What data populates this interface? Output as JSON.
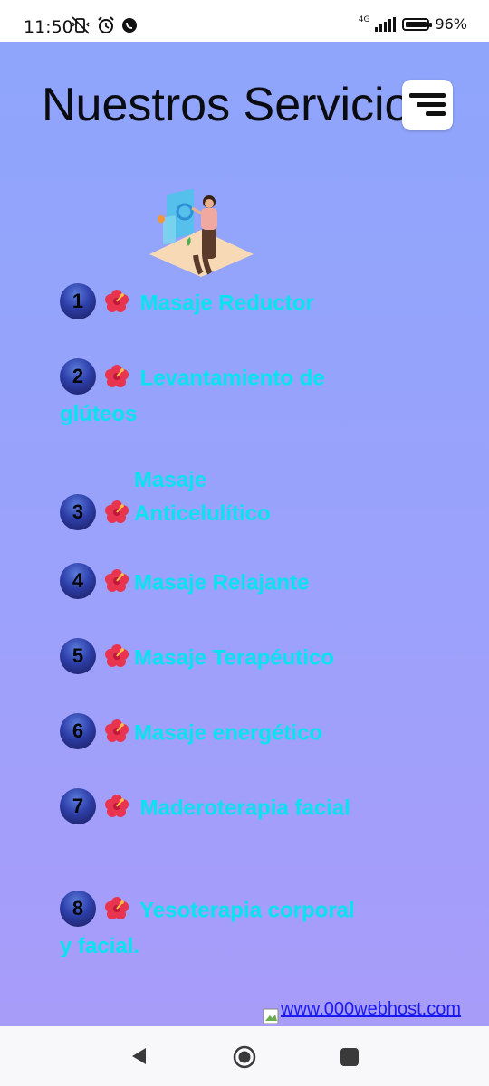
{
  "status_bar": {
    "time": "11:50",
    "network": "4G",
    "battery_percent": "96%",
    "battery_level": 0.96,
    "icons": [
      "vibrate-off-icon",
      "alarm-icon",
      "whatsapp-icon",
      "signal-icon",
      "battery-icon"
    ]
  },
  "page": {
    "title": "Nuestros Servicios",
    "menu_icon": "menu-icon",
    "background_gradient": [
      "#8ea5fb",
      "#a89cf9"
    ],
    "accent_text_color": "#07e3ef"
  },
  "services": [
    {
      "number": "1",
      "icon": "hibiscus-icon",
      "label": "Masaje Reductor"
    },
    {
      "number": "2",
      "icon": "hibiscus-icon",
      "label": "Levantamiento de glúteos"
    },
    {
      "number": "3",
      "icon": "hibiscus-icon",
      "label": "Masaje Anticelulítico"
    },
    {
      "number": "4",
      "icon": "hibiscus-icon",
      "label": "Masaje Relajante"
    },
    {
      "number": "5",
      "icon": "hibiscus-icon",
      "label": "Masaje Terapéutico"
    },
    {
      "number": "6",
      "icon": "hibiscus-icon",
      "label": "Masaje energético"
    },
    {
      "number": "7",
      "icon": "hibiscus-icon",
      "label": "Maderoterapia facial"
    },
    {
      "number": "8",
      "icon": "hibiscus-icon",
      "label": "Yesoterapia corporal y facial."
    }
  ],
  "footer": {
    "link_text": "www.000webhost.com"
  },
  "nav_bar": {
    "buttons": [
      "back-icon",
      "home-icon",
      "recents-icon"
    ]
  }
}
